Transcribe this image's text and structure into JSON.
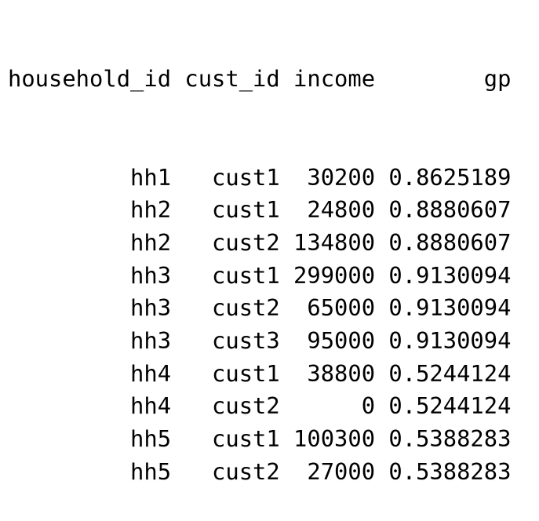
{
  "table": {
    "headers": [
      "household_id",
      "cust_id",
      "income",
      "gp"
    ],
    "rows": [
      [
        "hh1",
        "cust1",
        "30200",
        "0.8625189"
      ],
      [
        "hh2",
        "cust1",
        "24800",
        "0.8880607"
      ],
      [
        "hh2",
        "cust2",
        "134800",
        "0.8880607"
      ],
      [
        "hh3",
        "cust1",
        "299000",
        "0.9130094"
      ],
      [
        "hh3",
        "cust2",
        "65000",
        "0.9130094"
      ],
      [
        "hh3",
        "cust3",
        "95000",
        "0.9130094"
      ],
      [
        "hh4",
        "cust1",
        "38800",
        "0.5244124"
      ],
      [
        "hh4",
        "cust2",
        "0",
        "0.5244124"
      ],
      [
        "hh5",
        "cust1",
        "100300",
        "0.5388283"
      ],
      [
        "hh5",
        "cust2",
        "27000",
        "0.5388283"
      ]
    ]
  }
}
